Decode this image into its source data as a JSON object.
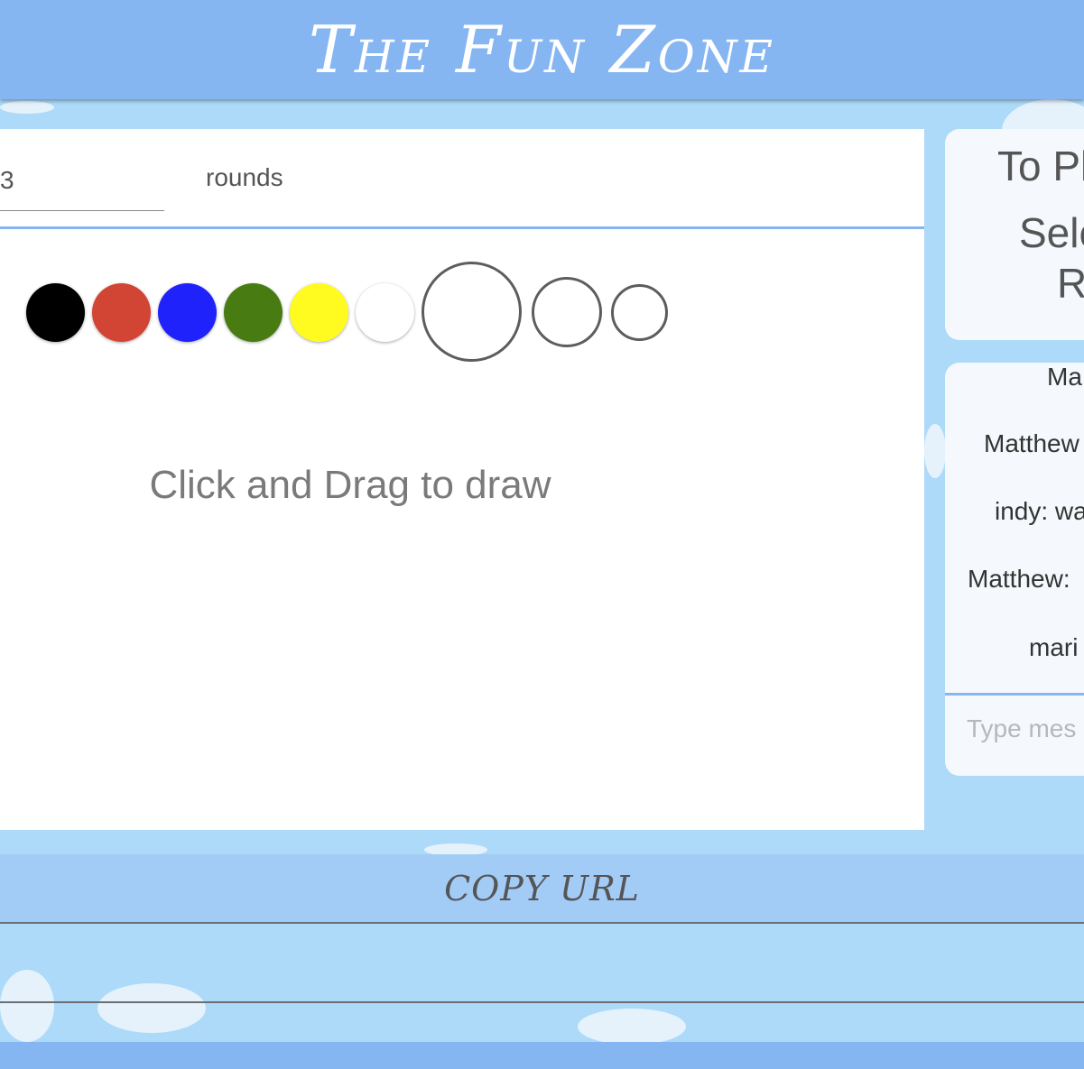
{
  "header": {
    "title": "The Fun Zone"
  },
  "settings": {
    "rounds_value": "3",
    "rounds_label": "rounds"
  },
  "palette": {
    "colors": [
      "#000000",
      "#d24434",
      "#1f22fb",
      "#487c12",
      "#fffb21",
      "#ffffff"
    ],
    "brush_sizes": [
      "large-brush",
      "medium-brush",
      "small-brush"
    ]
  },
  "canvas": {
    "hint": "Click and Drag to draw"
  },
  "instructions": {
    "line1": "To Pl",
    "line2": "Sele",
    "line3": "R"
  },
  "chat": {
    "messages": [
      "Ma",
      "Matthew",
      "indy: wa",
      "Matthew:",
      "mari"
    ],
    "input_placeholder": "Type mes"
  },
  "actions": {
    "copy_url_label": "COPY URL"
  }
}
